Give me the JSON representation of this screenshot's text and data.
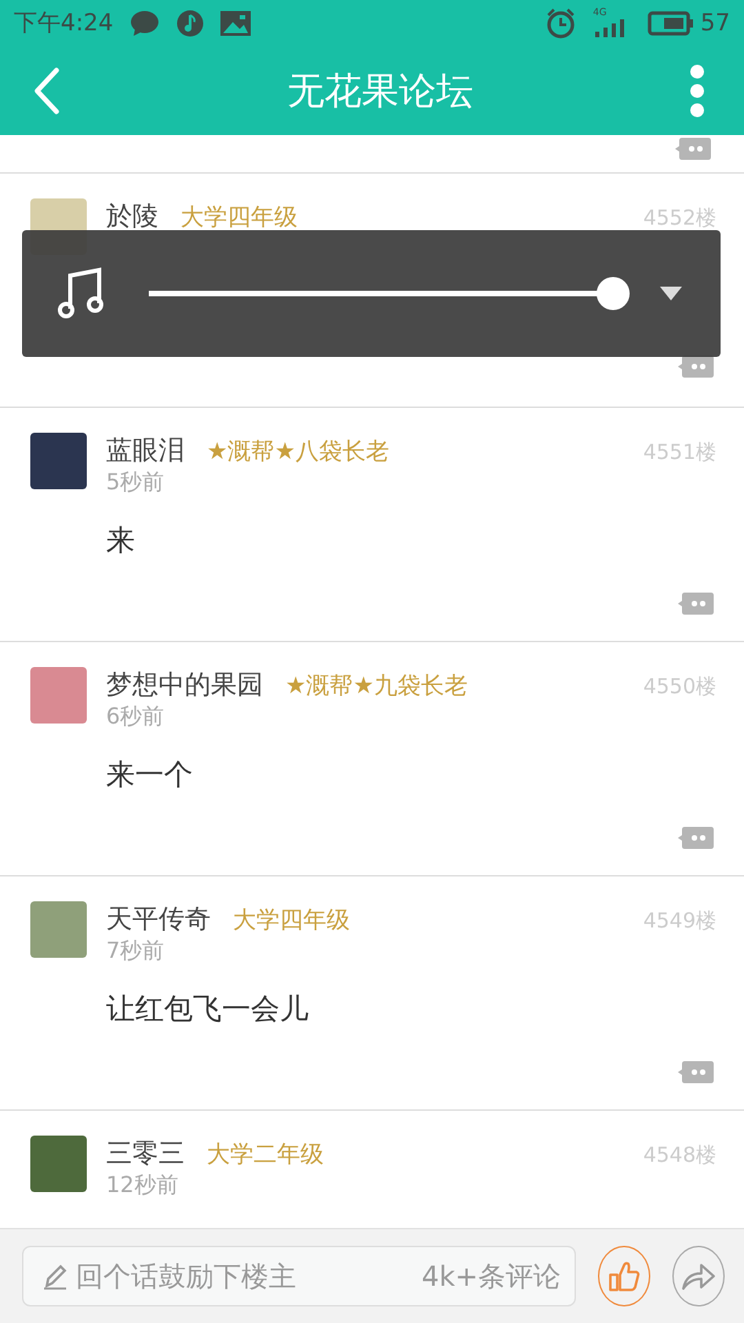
{
  "status_bar": {
    "time": "下午4:24",
    "network": "4G",
    "battery": "57"
  },
  "header": {
    "title": "无花果论坛"
  },
  "posts": [
    {
      "name": "於陵",
      "rank": "大学四年级",
      "floor": "4552楼"
    },
    {
      "name": "蓝眼泪",
      "rank": "★溉帮★八袋长老",
      "time": "5秒前",
      "floor": "4551楼",
      "content": "来"
    },
    {
      "name": "梦想中的果园",
      "rank": "★溉帮★九袋长老",
      "time": "6秒前",
      "floor": "4550楼",
      "content": "来一个"
    },
    {
      "name": "天平传奇",
      "rank": "大学四年级",
      "time": "7秒前",
      "floor": "4549楼",
      "content": "让红包飞一会儿"
    },
    {
      "name": "三零三",
      "rank": "大学二年级",
      "time": "12秒前",
      "floor": "4548楼"
    }
  ],
  "player": {
    "level": 1.0
  },
  "reply_bar": {
    "placeholder": "回个话鼓励下楼主",
    "comment_count": "4k+条评论"
  }
}
